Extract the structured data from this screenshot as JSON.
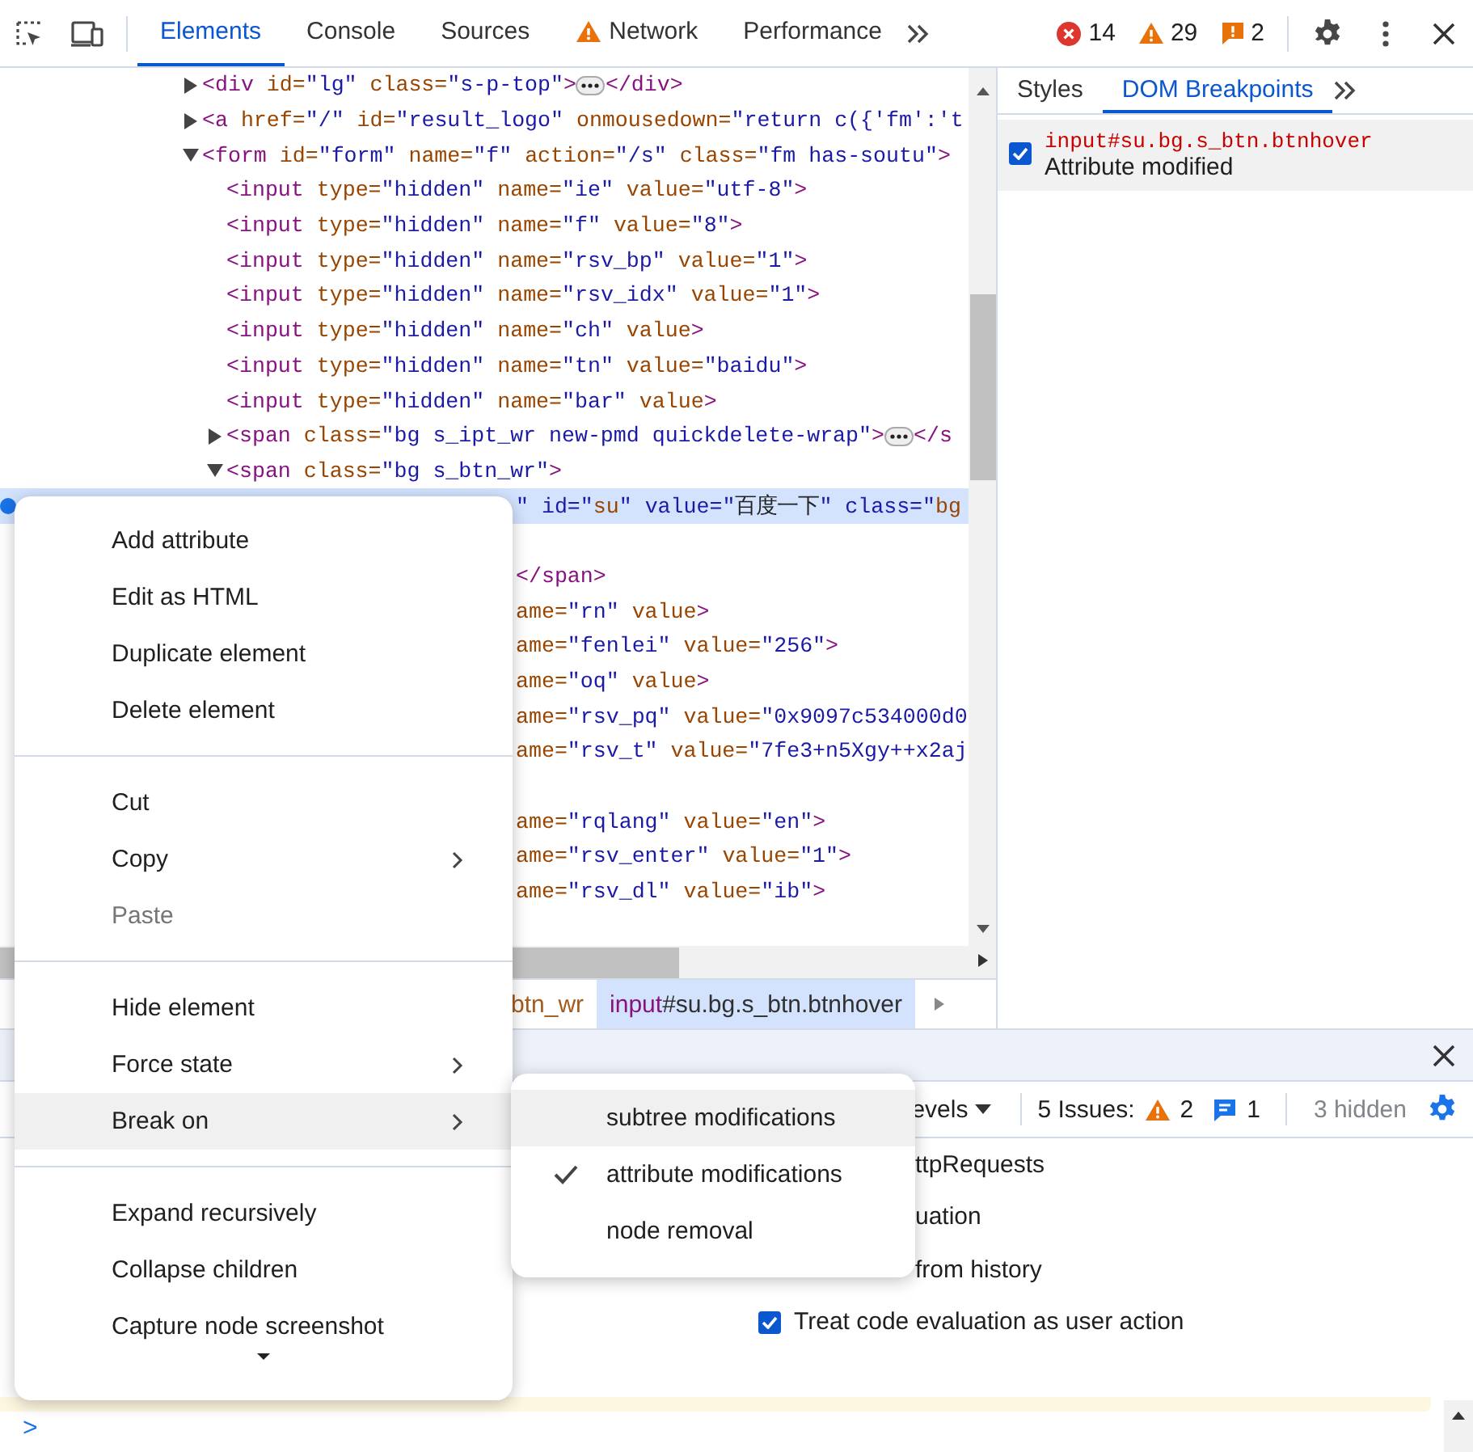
{
  "toolbar": {
    "tabs": [
      {
        "label": "Elements",
        "selected": true,
        "kind": "plain"
      },
      {
        "label": "Console",
        "selected": false,
        "kind": "plain"
      },
      {
        "label": "Sources",
        "selected": false,
        "kind": "plain"
      },
      {
        "label": "Network",
        "selected": false,
        "kind": "warning"
      },
      {
        "label": "Performance",
        "selected": false,
        "kind": "plain"
      }
    ],
    "counters": [
      {
        "kind": "error",
        "count": "14"
      },
      {
        "kind": "warning",
        "count": "29"
      },
      {
        "kind": "issue",
        "count": "2"
      }
    ]
  },
  "dom_tree": [
    {
      "kind": "parent",
      "expanded": false,
      "selected": false,
      "breakpoint": false,
      "text": "<div id=\"lg\" class=\"s-p-top\">",
      "closing": "</div>"
    },
    {
      "kind": "parent",
      "expanded": false,
      "selected": false,
      "breakpoint": false,
      "text": "<a href=\"/\" id=\"result_logo\" onmousedown=\"return c({'fm':'t"
    },
    {
      "kind": "parent",
      "expanded": true,
      "selected": false,
      "breakpoint": false,
      "text": "<form id=\"form\" name=\"f\" action=\"/s\" class=\"fm  has-soutu\">",
      "children": [
        {
          "kind": "leaf",
          "selected": false,
          "breakpoint": false,
          "text": "<input type=\"hidden\" name=\"ie\" value=\"utf-8\">"
        },
        {
          "kind": "leaf",
          "selected": false,
          "breakpoint": false,
          "text": "<input type=\"hidden\" name=\"f\" value=\"8\">"
        },
        {
          "kind": "leaf",
          "selected": false,
          "breakpoint": false,
          "text": "<input type=\"hidden\" name=\"rsv_bp\" value=\"1\">"
        },
        {
          "kind": "leaf",
          "selected": false,
          "breakpoint": false,
          "text": "<input type=\"hidden\" name=\"rsv_idx\" value=\"1\">"
        },
        {
          "kind": "leaf",
          "selected": false,
          "breakpoint": false,
          "text": "<input type=\"hidden\" name=\"ch\" value>"
        },
        {
          "kind": "leaf",
          "selected": false,
          "breakpoint": false,
          "text": "<input type=\"hidden\" name=\"tn\" value=\"baidu\">"
        },
        {
          "kind": "leaf",
          "selected": false,
          "breakpoint": false,
          "text": "<input type=\"hidden\" name=\"bar\" value>"
        },
        {
          "kind": "parent",
          "expanded": false,
          "selected": false,
          "breakpoint": false,
          "text": "<span class=\"bg s_ipt_wr new-pmd quickdelete-wrap\">",
          "closing": "</s"
        },
        {
          "kind": "parent",
          "expanded": true,
          "selected": false,
          "breakpoint": false,
          "text": "<span class=\"bg s_btn_wr\">",
          "children": [
            {
              "kind": "partial",
              "selected": true,
              "breakpoint": true,
              "text": "\" id=\"su\" value=\"百度一下\" class=\"bg"
            },
            {
              "kind": "hidden",
              "selected": false
            },
            {
              "kind": "partial",
              "selected": false,
              "breakpoint": false,
              "text": "</span>"
            }
          ]
        },
        {
          "kind": "partial",
          "selected": false,
          "breakpoint": false,
          "text": "ame=\"rn\" value>"
        },
        {
          "kind": "partial",
          "selected": false,
          "breakpoint": false,
          "text": "ame=\"fenlei\" value=\"256\">"
        },
        {
          "kind": "partial",
          "selected": false,
          "breakpoint": false,
          "text": "ame=\"oq\" value>"
        },
        {
          "kind": "partial",
          "selected": false,
          "breakpoint": false,
          "text": "ame=\"rsv_pq\" value=\"0x9097c534000d0"
        },
        {
          "kind": "partial",
          "selected": false,
          "breakpoint": false,
          "text": "ame=\"rsv_t\" value=\"7fe3+n5Xgy++x2aj"
        },
        {
          "kind": "hidden",
          "selected": false
        },
        {
          "kind": "partial",
          "selected": false,
          "breakpoint": false,
          "text": "ame=\"rqlang\" value=\"en\">"
        },
        {
          "kind": "partial",
          "selected": false,
          "breakpoint": false,
          "text": "ame=\"rsv_enter\" value=\"1\">"
        },
        {
          "kind": "partial",
          "selected": false,
          "breakpoint": false,
          "text": "ame=\"rsv_dl\" value=\"ib\">"
        }
      ]
    }
  ],
  "breadcrumbs": [
    {
      "text": "btn_wr",
      "selected": false
    },
    {
      "text": "input#su.bg.s_btn.btnhover",
      "selected": true
    }
  ],
  "side_panel": {
    "tabs": [
      {
        "label": "Styles",
        "selected": false
      },
      {
        "label": "DOM Breakpoints",
        "selected": true
      }
    ],
    "breakpoints": [
      {
        "selector": "input#su.bg.s_btn.btnhover",
        "type": "Attribute modified",
        "checked": true
      }
    ]
  },
  "drawer": {
    "levels": "evels",
    "issues_label": "5 Issues:",
    "issue_counts": [
      {
        "kind": "warning",
        "count": "2"
      },
      {
        "kind": "info",
        "count": "1"
      }
    ],
    "hidden": "3 hidden",
    "settings": [
      {
        "kind": "covered",
        "label": "ttpRequests"
      },
      {
        "kind": "covered",
        "label": "uation"
      },
      {
        "kind": "covered",
        "label": "from history"
      },
      {
        "kind": "checkbox",
        "label": "Treat code evaluation as user action",
        "checked": true
      }
    ],
    "prompt": ">"
  },
  "context_menu": {
    "groups": [
      [
        {
          "label": "Add attribute",
          "submenu": false,
          "disabled": false,
          "selected": false
        },
        {
          "label": "Edit as HTML",
          "submenu": false,
          "disabled": false,
          "selected": false
        },
        {
          "label": "Duplicate element",
          "submenu": false,
          "disabled": false,
          "selected": false
        },
        {
          "label": "Delete element",
          "submenu": false,
          "disabled": false,
          "selected": false
        }
      ],
      [
        {
          "label": "Cut",
          "submenu": false,
          "disabled": false,
          "selected": false
        },
        {
          "label": "Copy",
          "submenu": true,
          "disabled": false,
          "selected": false
        },
        {
          "label": "Paste",
          "submenu": false,
          "disabled": true,
          "selected": false
        }
      ],
      [
        {
          "label": "Hide element",
          "submenu": false,
          "disabled": false,
          "selected": false
        },
        {
          "label": "Force state",
          "submenu": true,
          "disabled": false,
          "selected": false
        },
        {
          "label": "Break on",
          "submenu": true,
          "disabled": false,
          "selected": true
        }
      ],
      [
        {
          "label": "Expand recursively",
          "submenu": false,
          "disabled": false,
          "selected": false
        },
        {
          "label": "Collapse children",
          "submenu": false,
          "disabled": false,
          "selected": false
        },
        {
          "label": "Capture node screenshot",
          "submenu": false,
          "disabled": false,
          "selected": false
        }
      ]
    ],
    "submenu": [
      {
        "label": "subtree modifications",
        "checked": false,
        "selected": true
      },
      {
        "label": "attribute modifications",
        "checked": true,
        "selected": false
      },
      {
        "label": "node removal",
        "checked": false,
        "selected": false
      }
    ]
  }
}
